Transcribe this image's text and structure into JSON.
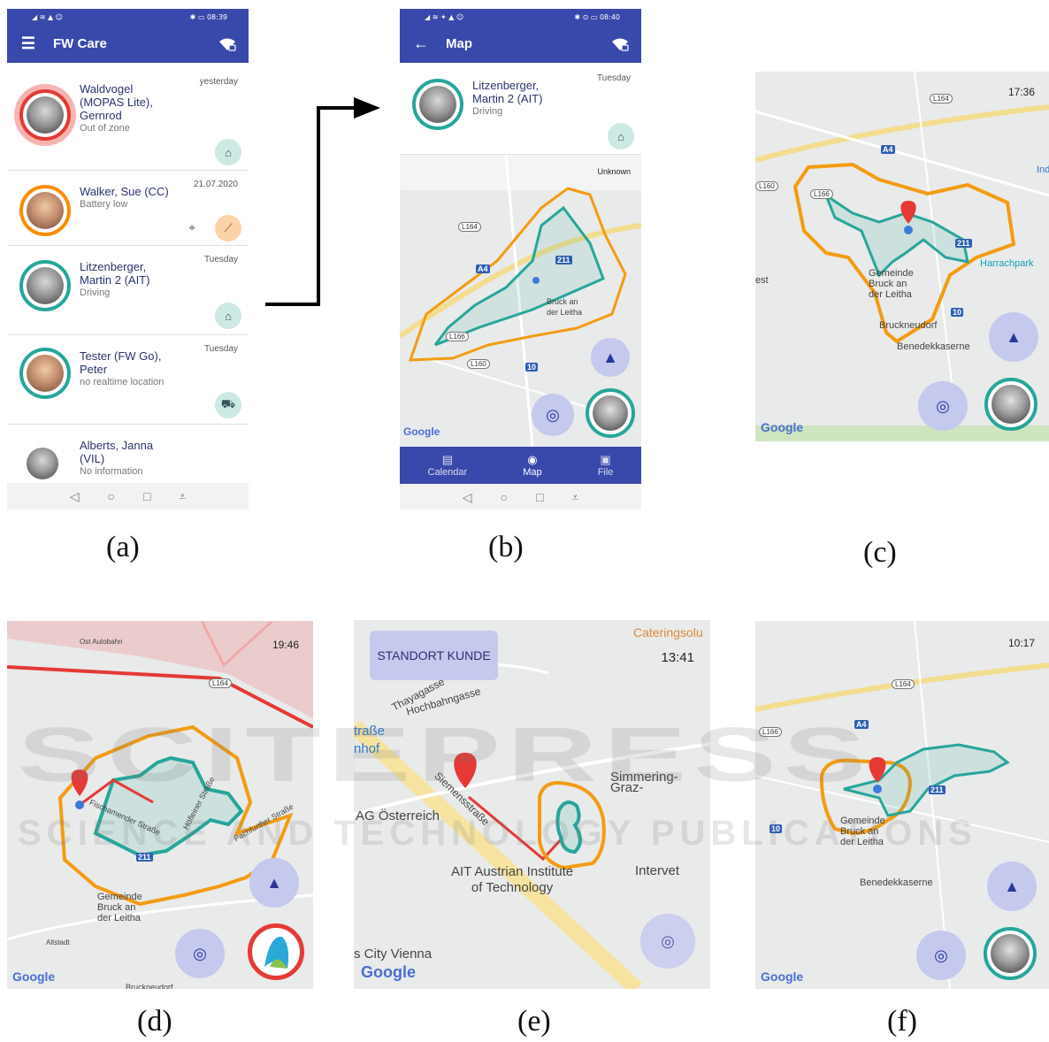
{
  "panel_a": {
    "status_left": "◢ ≋ ▲ ☺",
    "status_right": "✱ ▭ 08:39",
    "app_title": "FW Care",
    "items": [
      {
        "name": "Waldvogel (MOPAS Lite), Gernrod",
        "name_lines": [
          "Waldvogel",
          "(MOPAS Lite),",
          "Gernrod"
        ],
        "status": "Out of zone",
        "date": "yesterday",
        "ring_color": "#e53935"
      },
      {
        "name": "Walker, Sue (CC)",
        "name_lines": [
          "Walker, Sue (CC)"
        ],
        "status": "Battery low",
        "date": "21.07.2020",
        "ring_color": "#fb8c00"
      },
      {
        "name": "Litzenberger, Martin 2 (AIT)",
        "name_lines": [
          "Litzenberger,",
          "Martin 2 (AIT)"
        ],
        "status": "Driving",
        "date": "Tuesday",
        "ring_color": "#26a69a"
      },
      {
        "name": "Tester (FW Go), Peter",
        "name_lines": [
          "Tester (FW Go),",
          "Peter"
        ],
        "status": "no realtime location",
        "date": "Tuesday",
        "ring_color": "#26a69a"
      },
      {
        "name": "Alberts, Janna (VIL)",
        "name_lines": [
          "Alberts, Janna",
          "(VIL)"
        ],
        "status": "No information",
        "date": "",
        "ring_color": "#ffffff"
      }
    ]
  },
  "panel_b": {
    "status_left": "◢ ≋ ✦ ▲ ☺",
    "status_right": "✱ ⊙ ▭ 08:40",
    "app_title": "Map",
    "person": {
      "name_lines": [
        "Litzenberger,",
        "Martin 2 (AIT)"
      ],
      "status": "Driving",
      "date": "Tuesday"
    },
    "map_unknown": "Unknown",
    "town": [
      "Bruck an",
      "der Leitha"
    ],
    "google": "Google",
    "nav": [
      {
        "icon": "calendar-icon",
        "label": "Calendar"
      },
      {
        "icon": "map-pin-icon",
        "label": "Map"
      },
      {
        "icon": "folder-icon",
        "label": "File"
      }
    ]
  },
  "panel_c": {
    "time": "17:36",
    "labels": {
      "gemeinde": [
        "Gemeinde",
        "Bruck an",
        "der Leitha"
      ],
      "bruckneudorf": "Bruckneudorf",
      "benedekkaserne": "Benedekkaserne",
      "harrachpark": "Harrachpark",
      "est": "est",
      "ind": "Ind"
    },
    "google": "Google"
  },
  "panel_d": {
    "time": "19:46",
    "labels": {
      "autobahn": "Ost Autobahn",
      "gemeinde": [
        "Gemeinde",
        "Bruck an",
        "der Leitha"
      ],
      "altstadt": "Altstadt",
      "fisch": "Fischamender Straße",
      "pach": "Pachfurther Straße",
      "hoefl": "Höfleiner Straße",
      "bruckneudorf": "Bruckneudorf"
    },
    "google": "Google"
  },
  "panel_e": {
    "time": "13:41",
    "button": "STANDORT KUNDE",
    "labels": {
      "catering": "Cateringsolu",
      "thaya": "Thayagasse",
      "hochbahn": "Hochbahngasse",
      "strasse": "traße",
      "bahnhof": "nhof",
      "siemens": "Siemensstraße",
      "simmering": "Simmering-Graz-",
      "ag": "AG Österreich",
      "ait": [
        "AIT Austrian Institute",
        "of Technology"
      ],
      "intervet": "Intervet",
      "city": "s City Vienna"
    },
    "google": "Google"
  },
  "panel_f": {
    "time": "10:17",
    "labels": {
      "gemeinde": [
        "Gemeinde",
        "Bruck an",
        "der Leitha"
      ],
      "benedekkaserne": "Benedekkaserne"
    },
    "google": "Google"
  },
  "captions": [
    "(a)",
    "(b)",
    "(c)",
    "(d)",
    "(e)",
    "(f)"
  ],
  "watermark": "SCITEPRESS",
  "watermark_sub": "SCIENCE AND TECHNOLOGY PUBLICATIONS",
  "colors": {
    "primary": "#3949ab",
    "teal": "#26a69a",
    "orange": "#f39c12",
    "red": "#e53935"
  }
}
